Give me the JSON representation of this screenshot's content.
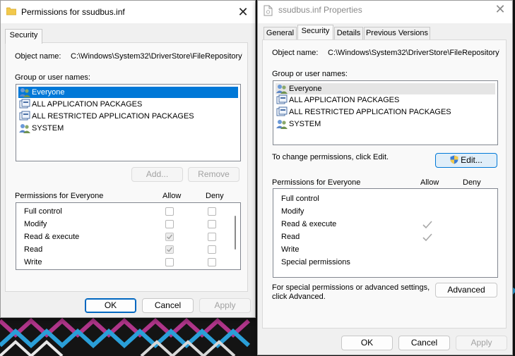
{
  "left_dialog": {
    "title": "Permissions for ssudbus.inf",
    "tab": "Security",
    "object_name_label": "Object name:",
    "object_name_value": "C:\\Windows\\System32\\DriverStore\\FileRepository\\",
    "groups_label": "Group or user names:",
    "groups": [
      "Everyone",
      "ALL APPLICATION PACKAGES",
      "ALL RESTRICTED APPLICATION PACKAGES",
      "SYSTEM"
    ],
    "add_label": "Add...",
    "remove_label": "Remove",
    "permissions_label": "Permissions for Everyone",
    "allow_label": "Allow",
    "deny_label": "Deny",
    "permissions": [
      {
        "name": "Full control",
        "allow": false,
        "deny": false
      },
      {
        "name": "Modify",
        "allow": false,
        "deny": false
      },
      {
        "name": "Read & execute",
        "allow": true,
        "deny": false
      },
      {
        "name": "Read",
        "allow": true,
        "deny": false
      },
      {
        "name": "Write",
        "allow": false,
        "deny": false
      }
    ],
    "ok_label": "OK",
    "cancel_label": "Cancel",
    "apply_label": "Apply"
  },
  "right_dialog": {
    "title": "ssudbus.inf Properties",
    "tabs": [
      "General",
      "Security",
      "Details",
      "Previous Versions"
    ],
    "active_tab": "Security",
    "object_name_label": "Object name:",
    "object_name_value": "C:\\Windows\\System32\\DriverStore\\FileRepository\\",
    "groups_label": "Group or user names:",
    "groups": [
      "Everyone",
      "ALL APPLICATION PACKAGES",
      "ALL RESTRICTED APPLICATION PACKAGES",
      "SYSTEM"
    ],
    "change_text": "To change permissions, click Edit.",
    "edit_label": "Edit...",
    "permissions_label": "Permissions for Everyone",
    "allow_label": "Allow",
    "deny_label": "Deny",
    "permissions": [
      {
        "name": "Full control",
        "allow": false,
        "deny": false
      },
      {
        "name": "Modify",
        "allow": false,
        "deny": false
      },
      {
        "name": "Read & execute",
        "allow": true,
        "deny": false
      },
      {
        "name": "Read",
        "allow": true,
        "deny": false
      },
      {
        "name": "Write",
        "allow": false,
        "deny": false
      },
      {
        "name": "Special permissions",
        "allow": false,
        "deny": false
      }
    ],
    "special_text_1": "For special permissions or advanced settings,",
    "special_text_2": "click Advanced.",
    "advanced_label": "Advanced",
    "ok_label": "OK",
    "cancel_label": "Cancel",
    "apply_label": "Apply"
  },
  "icons": {
    "folder": "folder-icon",
    "file": "file-icon",
    "users": "users-icon",
    "package": "package-icon",
    "shield": "uac-shield-icon",
    "close": "close-icon",
    "check": "check-icon"
  },
  "colors": {
    "accent": "#0078d7",
    "window_bg": "#f0f0f0",
    "desktop_bg": "#111111"
  }
}
